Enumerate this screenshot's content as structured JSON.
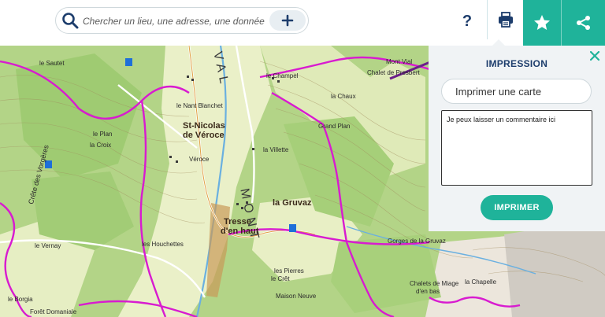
{
  "search": {
    "placeholder": "Chercher un lieu, une adresse, une donnée",
    "icon": "search-icon",
    "add_icon": "plus-icon"
  },
  "toolbar": {
    "help_label": "?",
    "print_icon": "printer-icon",
    "favorite_icon": "star-icon",
    "share_icon": "share-icon"
  },
  "print_panel": {
    "title": "IMPRESSION",
    "title_input_value": "Imprimer une carte",
    "comment_value": "Je peux laisser un commentaire ici",
    "print_button_label": "IMPRIMER",
    "close_icon": "close-icon"
  },
  "map": {
    "labels": {
      "le_champel": "le Champel",
      "chalet_presbert": "Chalet de Presbert",
      "st_nicolas_1": "St-Nicolas",
      "st_nicolas_2": "de Véroce",
      "la_villette": "la Villette",
      "la_gruvaz": "la Gruvaz",
      "tresse_1": "Tresse",
      "tresse_2": "d'en haut",
      "gorges": "Gorges de la Gruvaz",
      "le_nant_blanchet": "le Nant Blanchet",
      "veroce": "Véroce",
      "grand_plan": "Grand Plan",
      "le_cret": "le Crêt",
      "les_houchettes": "les Houchettes",
      "le_plan": "le Plan",
      "la_croix": "la Croix",
      "le_sautet": "le Sautet",
      "mont_vial": "Mont Vial",
      "le_vernay": "le Vernay",
      "le_borgia": "le Borgia",
      "foret_domaniale": "Forêt Domaniale",
      "chalets_miage_1": "Chalets de Miage",
      "chalets_miage_2": "d'en bas",
      "la_chapelle": "la Chapelle",
      "les_pierres": "les Pierres",
      "maison_neuve": "Maison Neuve",
      "lac_de": "la Chaux",
      "valley_1": "VAL",
      "valley_2": "MONT",
      "cote_de_la_vierge": "Crête des Vorgères"
    },
    "colors": {
      "route": "#d81bd0",
      "road": "#ffffff",
      "river": "#6ab0e0",
      "meadow": "#eef3cc",
      "forest": "#a6cf79",
      "rock": "#d6d1c8",
      "annotation": "#6b1f8a"
    }
  }
}
